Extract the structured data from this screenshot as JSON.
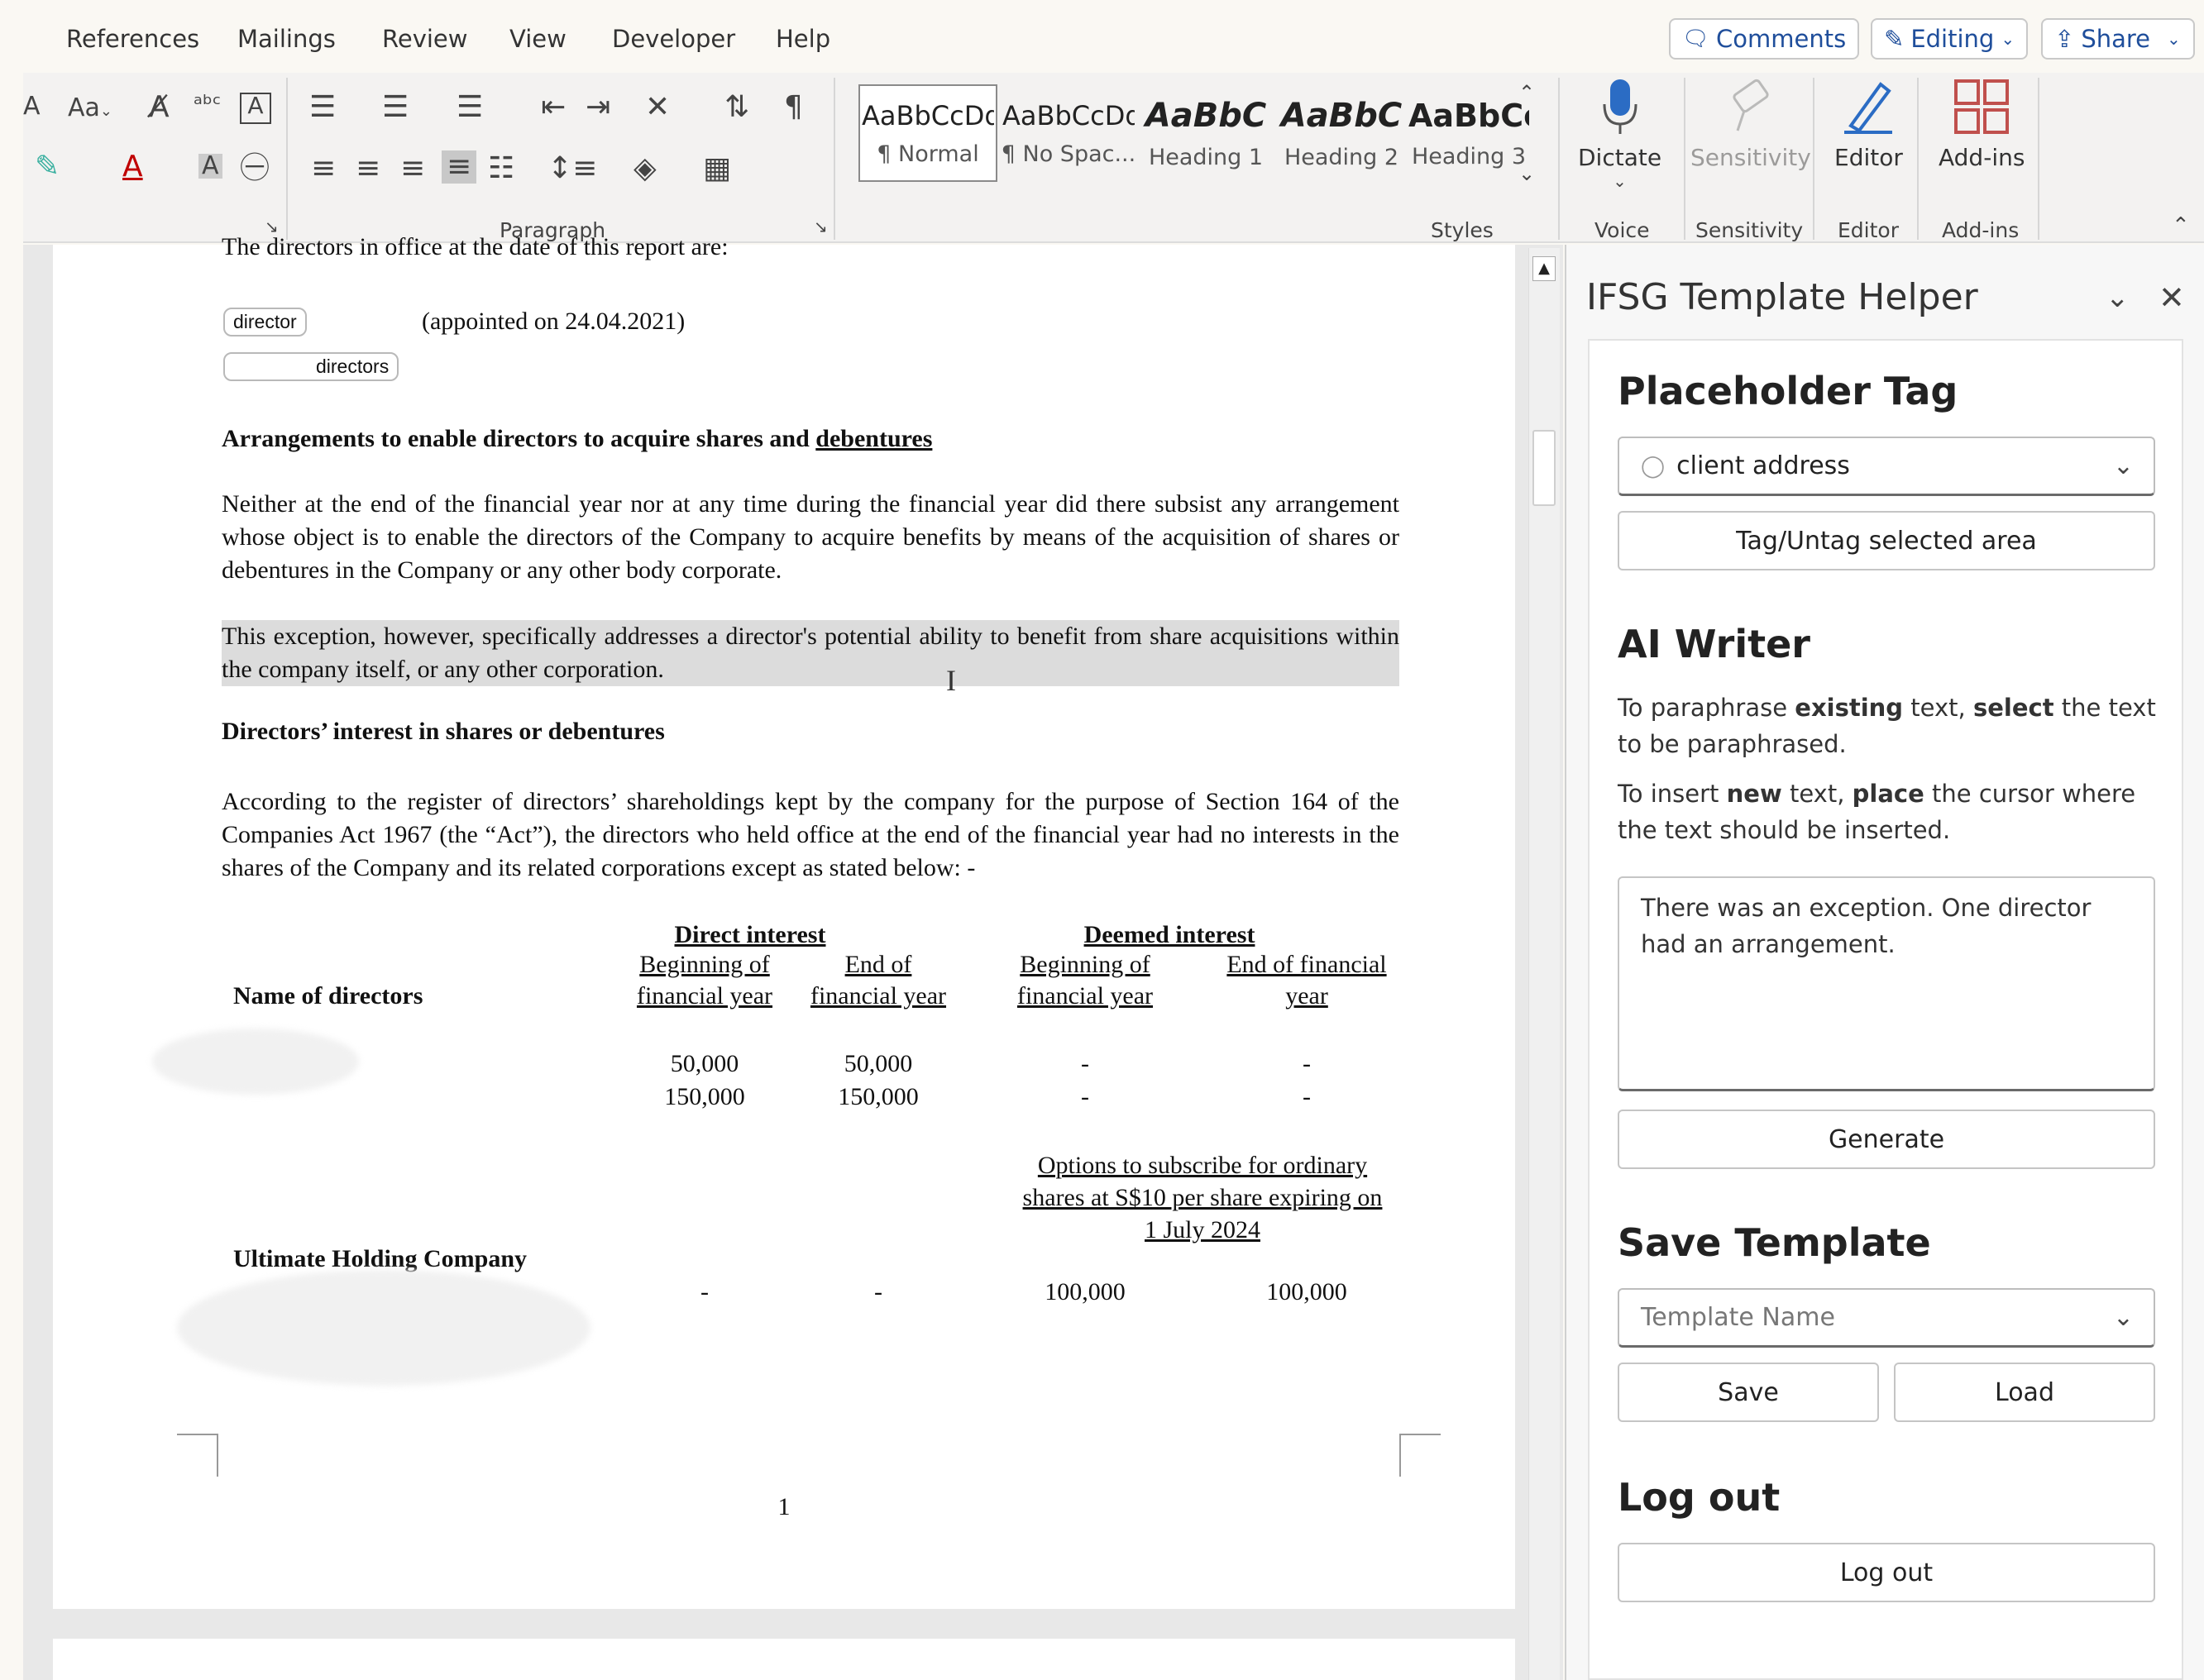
{
  "menu": {
    "items": [
      "References",
      "Mailings",
      "Review",
      "View",
      "Developer",
      "Help"
    ],
    "comments": "Comments",
    "editing": "Editing",
    "share": "Share"
  },
  "ribbon": {
    "paragraph_label": "Paragraph",
    "styles_label": "Styles",
    "styles": [
      {
        "sample": "AaBbCcDd",
        "name": "¶ Normal"
      },
      {
        "sample": "AaBbCcDd",
        "name": "¶ No Spac..."
      },
      {
        "sample": "AaBbC",
        "name": "Heading 1"
      },
      {
        "sample": "AaBbC",
        "name": "Heading 2"
      },
      {
        "sample": "AaBbCc",
        "name": "Heading 3"
      }
    ],
    "dictate": "Dictate",
    "voice_label": "Voice",
    "sensitivity": "Sensitivity",
    "sensitivity_label": "Sensitivity",
    "editor": "Editor",
    "editor_label": "Editor",
    "addins": "Add-ins",
    "addins_label": "Add-ins",
    "font_case": "Aa",
    "font_size_small": "A"
  },
  "document": {
    "cut_line": "The directors in office at the date of this report are:",
    "tag_director": "director",
    "appointed": "(appointed on 24.04.2021)",
    "tag_directors": "directors",
    "heading1": "Arrangements to enable directors to acquire shares and",
    "heading1_link": "debentures",
    "para1": "Neither at the end of the financial year nor at any time during the financial year did there subsist any arrangement whose object is to enable the directors of the Company to acquire benefits by means of the acquisition of shares or debentures in the Company or any other body corporate.",
    "para2": "This exception, however, specifically addresses a director's potential ability to benefit from share acquisitions within the company itself, or any other corporation.",
    "heading2": "Directors’ interest in shares or debentures",
    "para3": "According to the register of directors’ shareholdings kept by the company for the purpose of Section 164 of the Companies Act 1967 (the “Act”), the directors who held office at the end of the financial year had no interests in the shares of the Company and its related corporations except as stated below: -",
    "table": {
      "direct_interest": "Direct interest",
      "deemed_interest": "Deemed interest",
      "beginning_of": "Beginning of",
      "financial_year": "financial year",
      "end_of": "End of",
      "end_of_financial": "End of financial",
      "year": "year",
      "name_of_directors": "Name of directors",
      "rows": [
        [
          "50,000",
          "50,000",
          "-",
          "-"
        ],
        [
          "150,000",
          "150,000",
          "-",
          "-"
        ]
      ],
      "options_line1": "Options to subscribe for ordinary",
      "options_line2": "shares at S$10 per share expiring on",
      "options_line3": "1 July 2024",
      "ultimate": "Ultimate Holding Company",
      "row3": [
        "-",
        "-",
        "100,000",
        "100,000"
      ]
    },
    "page_number": "1"
  },
  "panel": {
    "title": "IFSG Template Helper",
    "placeholder_heading": "Placeholder Tag",
    "placeholder_value": "client address",
    "tag_button": "Tag/Untag selected area",
    "ai_heading": "AI Writer",
    "ai_text1_a": "To paraphrase ",
    "ai_text1_b": "existing",
    "ai_text1_c": " text, ",
    "ai_text1_d": "select",
    "ai_text1_e": " the text to be paraphrased.",
    "ai_text2_a": "To insert ",
    "ai_text2_b": "new",
    "ai_text2_c": " text, ",
    "ai_text2_d": "place",
    "ai_text2_e": " the cursor where the text should be inserted.",
    "ai_input": "There was an exception. One director had an arrangement.",
    "generate": "Generate",
    "save_heading": "Save Template",
    "template_placeholder": "Template Name",
    "save": "Save",
    "load": "Load",
    "logout_heading": "Log out",
    "logout": "Log out"
  }
}
